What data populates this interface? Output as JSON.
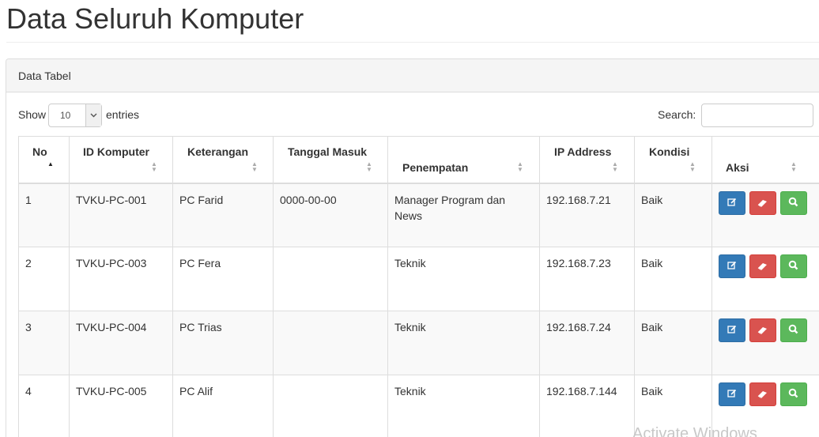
{
  "page": {
    "title": "Data Seluruh Komputer"
  },
  "panel": {
    "heading": "Data Tabel"
  },
  "controls": {
    "show_label": "Show",
    "length_value": "10",
    "entries_label": "entries",
    "search_label": "Search:",
    "search_value": ""
  },
  "table": {
    "columns": [
      "No",
      "ID Komputer",
      "Keterangan",
      "Tanggal Masuk",
      "Penempatan",
      "IP Address",
      "Kondisi",
      "Aksi"
    ],
    "sorted_column": "No",
    "sort_direction": "ascending",
    "rows": [
      {
        "no": "1",
        "id": "TVKU-PC-001",
        "keterangan": "PC Farid",
        "tanggal": "0000-00-00",
        "penempatan": "Manager Program dan News",
        "ip": "192.168.7.21",
        "kondisi": "Baik"
      },
      {
        "no": "2",
        "id": "TVKU-PC-003",
        "keterangan": "PC Fera",
        "tanggal": "",
        "penempatan": "Teknik",
        "ip": "192.168.7.23",
        "kondisi": "Baik"
      },
      {
        "no": "3",
        "id": "TVKU-PC-004",
        "keterangan": "PC Trias",
        "tanggal": "",
        "penempatan": "Teknik",
        "ip": "192.168.7.24",
        "kondisi": "Baik"
      },
      {
        "no": "4",
        "id": "TVKU-PC-005",
        "keterangan": "PC Alif",
        "tanggal": "",
        "penempatan": "Teknik",
        "ip": "192.168.7.144",
        "kondisi": "Baik"
      }
    ],
    "row_actions": [
      "edit-icon",
      "eraser-icon",
      "search-icon"
    ]
  },
  "watermark": {
    "text": "Activate Windows"
  },
  "colors": {
    "edit": "#337ab7",
    "delete": "#d9534f",
    "view": "#5cb85c"
  }
}
